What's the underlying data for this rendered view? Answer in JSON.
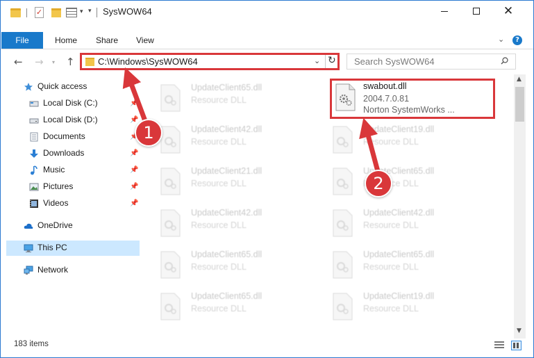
{
  "window": {
    "title": "SysWOW64",
    "controls": {
      "minimize": "",
      "maximize": "",
      "close": "✕"
    }
  },
  "ribbon": {
    "tabs": [
      {
        "label": "File"
      },
      {
        "label": "Home"
      },
      {
        "label": "Share"
      },
      {
        "label": "View"
      }
    ],
    "help": "?"
  },
  "address": {
    "path": "C:\\Windows\\SysWOW64",
    "search_placeholder": "Search SysWOW64"
  },
  "sidebar": {
    "items": [
      {
        "label": "Quick access",
        "icon": "star-icon"
      },
      {
        "label": "Local Disk (C:)",
        "icon": "drive-icon"
      },
      {
        "label": "Local Disk (D:)",
        "icon": "drive-icon"
      },
      {
        "label": "Documents",
        "icon": "documents-icon"
      },
      {
        "label": "Downloads",
        "icon": "download-icon"
      },
      {
        "label": "Music",
        "icon": "music-icon"
      },
      {
        "label": "Pictures",
        "icon": "pictures-icon"
      },
      {
        "label": "Videos",
        "icon": "videos-icon"
      },
      {
        "label": "OneDrive",
        "icon": "cloud-icon"
      },
      {
        "label": "This PC",
        "icon": "computer-icon"
      },
      {
        "label": "Network",
        "icon": "network-icon"
      }
    ]
  },
  "files": {
    "left_column": [
      {
        "name": "UpdateClient65.dll",
        "type": "Resource DLL"
      },
      {
        "name": "UpdateClient42.dll",
        "type": "Resource DLL"
      },
      {
        "name": "UpdateClient21.dll",
        "type": "Resource DLL"
      },
      {
        "name": "UpdateClient42.dll",
        "type": "Resource DLL"
      },
      {
        "name": "UpdateClient65.dll",
        "type": "Resource DLL"
      },
      {
        "name": "UpdateClient65.dll",
        "type": "Resource DLL"
      }
    ],
    "right_column": [
      {
        "name": "UpdateClient19.dll",
        "type": "Resource DLL"
      },
      {
        "name": "UpdateClient65.dll",
        "type": "Resource DLL"
      },
      {
        "name": "UpdateClient42.dll",
        "type": "Resource DLL"
      },
      {
        "name": "UpdateClient65.dll",
        "type": "Resource DLL"
      },
      {
        "name": "UpdateClient19.dll",
        "type": "Resource DLL"
      }
    ],
    "highlighted": {
      "name": "swabout.dll",
      "version": "2004.7.0.81",
      "company": "Norton SystemWorks ..."
    }
  },
  "status": {
    "item_count": "183 items"
  },
  "annotations": {
    "step1": "1",
    "step2": "2",
    "color": "#d9373a"
  }
}
